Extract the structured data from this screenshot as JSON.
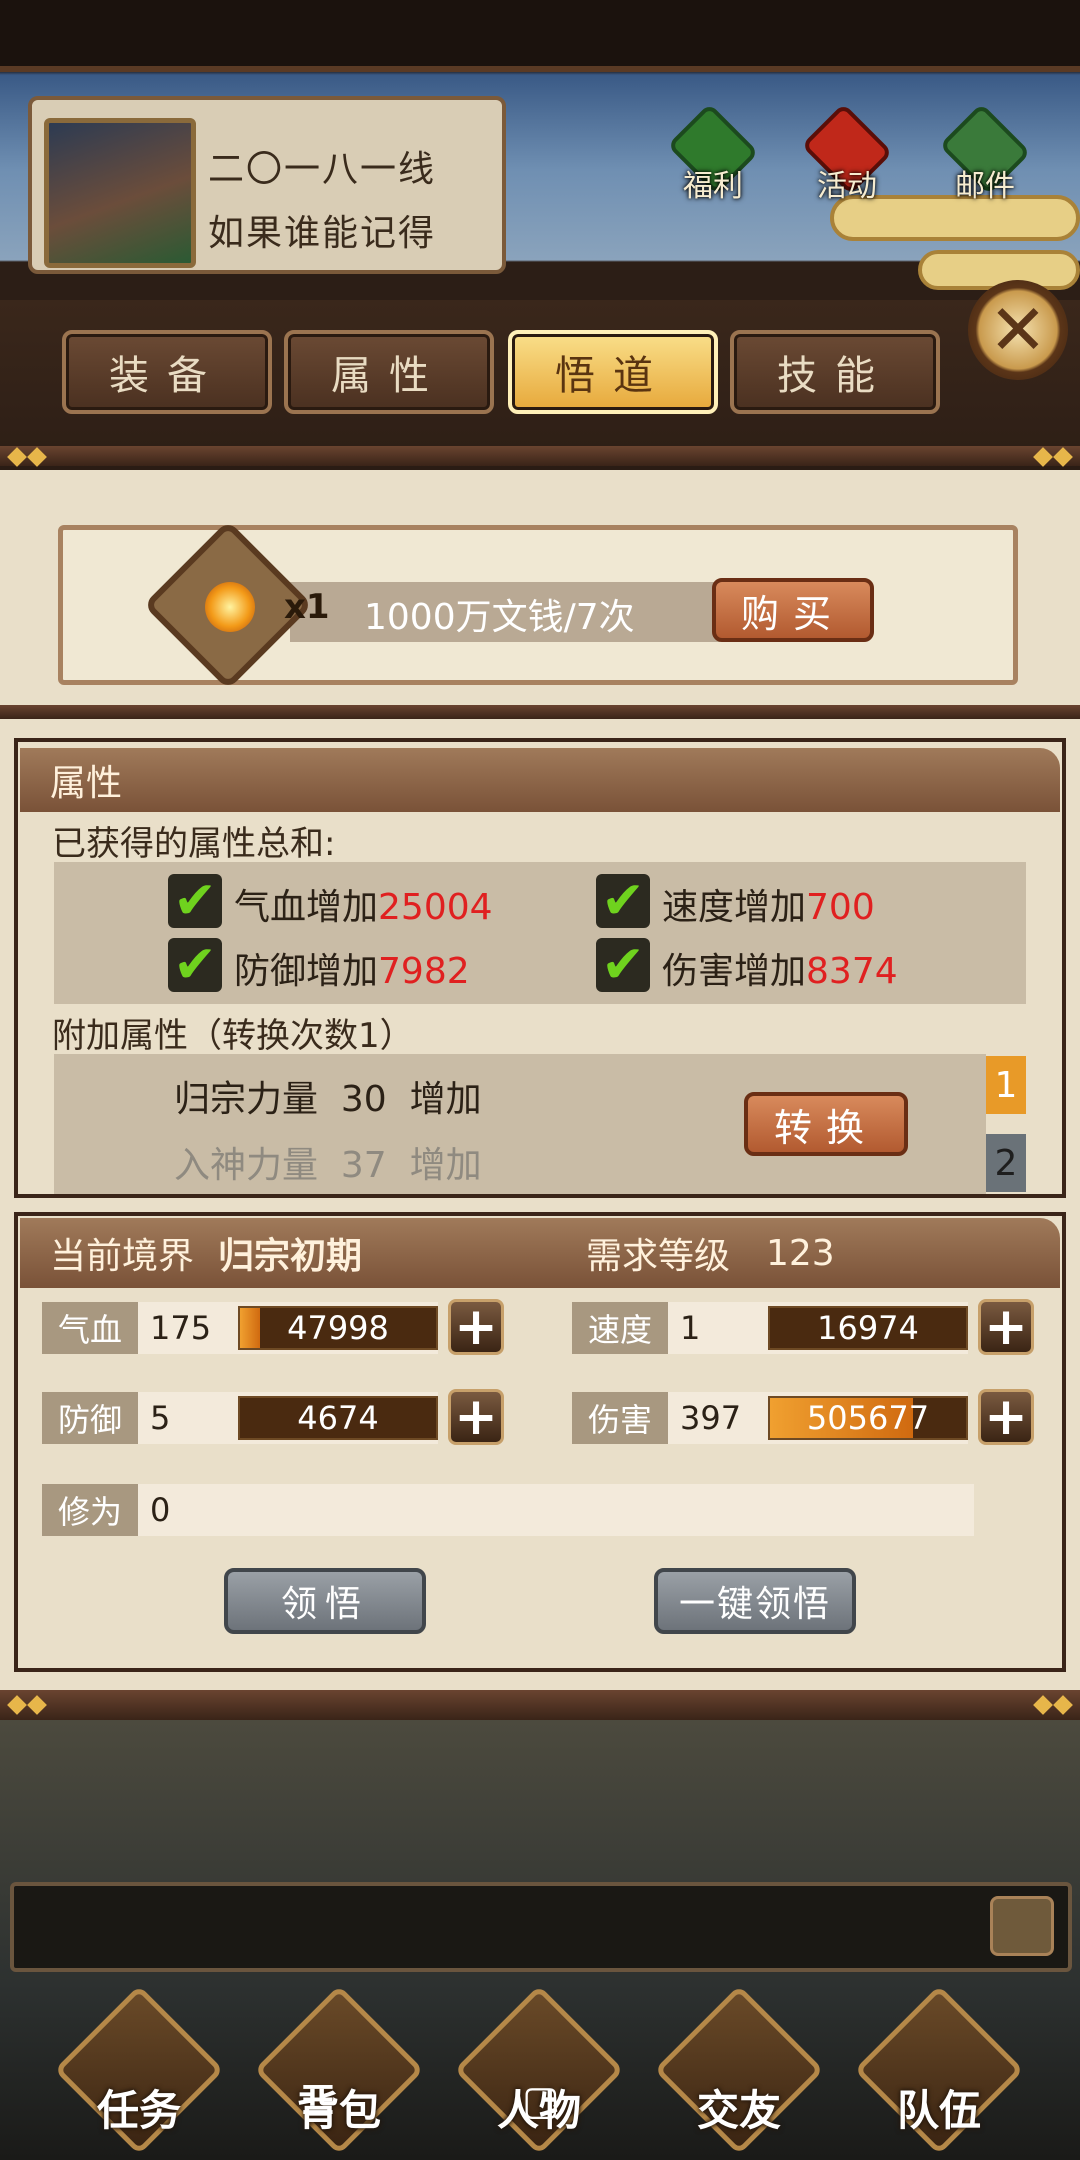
{
  "profile": {
    "name": "二〇一八一线",
    "subtitle": "如果谁能记得"
  },
  "top_icons": [
    {
      "label": "福利",
      "icon": "benefits-icon"
    },
    {
      "label": "活动",
      "icon": "event-gift-icon"
    },
    {
      "label": "邮件",
      "icon": "mail-icon"
    }
  ],
  "tabs": [
    {
      "label": "装备",
      "active": false
    },
    {
      "label": "属性",
      "active": false
    },
    {
      "label": "悟道",
      "active": true
    },
    {
      "label": "技能",
      "active": false
    }
  ],
  "buy": {
    "quantity": "x1",
    "price": "1000万文钱/7次",
    "button": "购买"
  },
  "attributes": {
    "title": "属性",
    "total_label": "已获得的属性总和:",
    "items": [
      {
        "label": "气血增加",
        "value": "25004"
      },
      {
        "label": "速度增加",
        "value": "700"
      },
      {
        "label": "防御增加",
        "value": "7982"
      },
      {
        "label": "伤害增加",
        "value": "8374"
      }
    ],
    "extra_label": "附加属性（转换次数1）",
    "extra_items": [
      {
        "name": "归宗力量",
        "value": "30",
        "suffix": "增加"
      },
      {
        "name": "入神力量",
        "value": "37",
        "suffix": "增加"
      }
    ],
    "convert_button": "转换",
    "pages": [
      "1",
      "2"
    ]
  },
  "realm": {
    "current_label": "当前境界",
    "current_value": "归宗初期",
    "required_label": "需求等级",
    "required_value": "123",
    "stats": [
      {
        "label": "气血",
        "level": "175",
        "points": "47998",
        "fill": 0.1
      },
      {
        "label": "速度",
        "level": "1",
        "points": "16974",
        "fill": 0.0
      },
      {
        "label": "防御",
        "level": "5",
        "points": "4674",
        "fill": 0.0
      },
      {
        "label": "伤害",
        "level": "397",
        "points": "505677",
        "fill": 0.73
      }
    ],
    "cultivation_label": "修为",
    "cultivation_value": "0",
    "comprehend_button": "领悟",
    "one_key_button": "一键领悟"
  },
  "bottom_nav": [
    {
      "label": "任务",
      "icon": "quest-scroll-icon"
    },
    {
      "label": "背包",
      "icon": "chest-icon"
    },
    {
      "label": "人物",
      "icon": "character-icon"
    },
    {
      "label": "交友",
      "icon": "friends-smiley-icon"
    },
    {
      "label": "队伍",
      "icon": "team-banner-icon"
    }
  ],
  "system_nav": {
    "menu": "☰",
    "home": "▢",
    "back": "‹"
  },
  "colors": {
    "highlight_red": "#e02020",
    "active_tab": "#e7a83a",
    "panel_bg": "#e9dfc9",
    "dark_brown": "#3a2418"
  }
}
